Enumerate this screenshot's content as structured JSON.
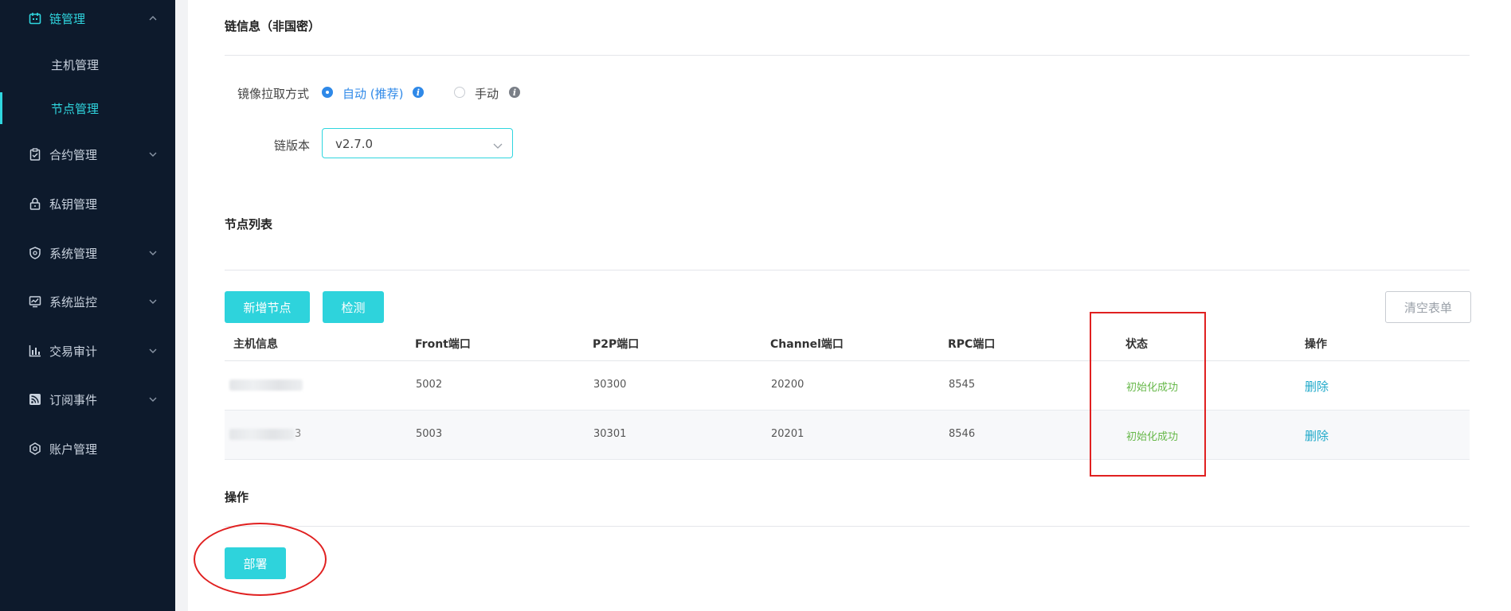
{
  "sidebar": {
    "items": [
      {
        "label": "链管理",
        "icon": "calendar-icon",
        "expanded": true
      },
      {
        "label": "合约管理",
        "icon": "clipboard-icon"
      },
      {
        "label": "私钥管理",
        "icon": "lock-icon"
      },
      {
        "label": "系统管理",
        "icon": "shield-icon"
      },
      {
        "label": "系统监控",
        "icon": "monitor-chart-icon"
      },
      {
        "label": "交易审计",
        "icon": "bar-chart-icon"
      },
      {
        "label": "订阅事件",
        "icon": "rss-icon"
      },
      {
        "label": "账户管理",
        "icon": "gear-hex-icon"
      }
    ],
    "subitems": [
      {
        "label": "主机管理"
      },
      {
        "label": "节点管理",
        "active": true
      }
    ]
  },
  "chain_info": {
    "title": "链信息（非国密）",
    "pull_label": "镜像拉取方式",
    "option_auto": "自动 (推荐)",
    "option_manual": "手动",
    "version_label": "链版本",
    "version_value": "v2.7.0"
  },
  "node_list": {
    "title": "节点列表",
    "add_button": "新增节点",
    "check_button": "检测",
    "clear_button": "清空表单",
    "columns": [
      "主机信息",
      "Front端口",
      "P2P端口",
      "Channel端口",
      "RPC端口",
      "状态",
      "操作"
    ],
    "rows": [
      {
        "host": "",
        "host_tail": "",
        "front": "5002",
        "p2p": "30300",
        "channel": "20200",
        "rpc": "8545",
        "status": "初始化成功",
        "action": "删除"
      },
      {
        "host": "",
        "host_tail": "3",
        "front": "5003",
        "p2p": "30301",
        "channel": "20201",
        "rpc": "8546",
        "status": "初始化成功",
        "action": "删除"
      }
    ]
  },
  "operation": {
    "title": "操作",
    "deploy_button": "部署"
  },
  "colors": {
    "accent": "#2ed3dc",
    "sidebar_bg": "#0d1a2c",
    "success": "#67b84a",
    "annotation": "#e02020"
  }
}
